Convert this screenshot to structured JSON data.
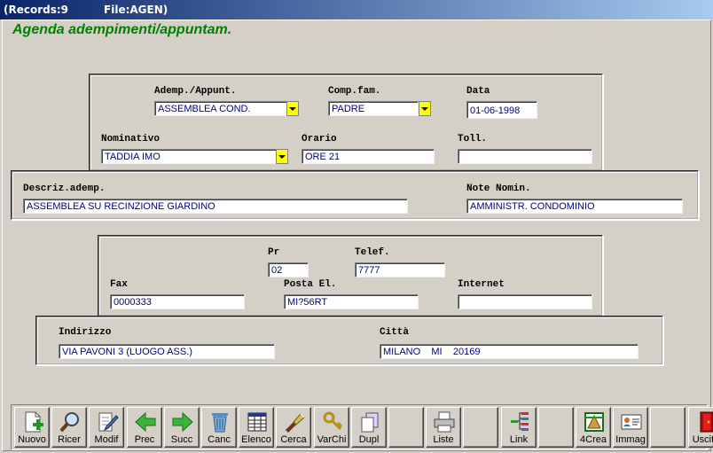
{
  "window": {
    "records": "(Records:9",
    "file": "File:AGEN)"
  },
  "heading": "Agenda adempimenti/appuntam.",
  "fields": {
    "adempimento": {
      "label": "Ademp./Appunt.",
      "value": "ASSEMBLEA COND."
    },
    "comp_fam": {
      "label": "Comp.fam.",
      "value": "PADRE"
    },
    "data": {
      "label": "Data",
      "value": "01-06-1998"
    },
    "nominativo": {
      "label": "Nominativo",
      "value": "TADDIA IMO"
    },
    "orario": {
      "label": "Orario",
      "value": "ORE 21"
    },
    "toll": {
      "label": "Toll.",
      "value": ""
    },
    "descrizione": {
      "label": "Descriz.ademp.",
      "value": "ASSEMBLEA SU RECINZIONE GIARDINO"
    },
    "note": {
      "label": "Note Nomin.",
      "value": "AMMINISTR. CONDOMINIO"
    },
    "pr": {
      "label": "Pr",
      "value": "02"
    },
    "telefono": {
      "label": "Telef.",
      "value": "7777"
    },
    "fax": {
      "label": "Fax",
      "value": "0000333"
    },
    "posta": {
      "label": "Posta El.",
      "value": "MI?56RT"
    },
    "internet": {
      "label": "Internet",
      "value": ""
    },
    "indirizzo": {
      "label": "Indirizzo",
      "value": "VIA PAVONI 3 (LUOGO ASS.)"
    },
    "citta": {
      "label": "Città",
      "value": "MILANO    MI    20169"
    }
  },
  "toolbar": [
    {
      "label": "Nuovo",
      "icon": "new-document-icon"
    },
    {
      "label": "Ricer",
      "icon": "magnifier-icon"
    },
    {
      "label": "Modif",
      "icon": "edit-document-icon"
    },
    {
      "label": "Prec",
      "icon": "arrow-left-icon"
    },
    {
      "label": "Succ",
      "icon": "arrow-right-icon"
    },
    {
      "label": "Canc",
      "icon": "trash-icon"
    },
    {
      "label": "Elenco",
      "icon": "table-icon"
    },
    {
      "label": "Cerca",
      "icon": "flashlight-icon"
    },
    {
      "label": "VarChi",
      "icon": "keys-icon"
    },
    {
      "label": "Dupl",
      "icon": "copy-icon"
    },
    {
      "label": "",
      "icon": ""
    },
    {
      "label": "Liste",
      "icon": "printer-icon"
    },
    {
      "label": "",
      "icon": ""
    },
    {
      "label": "Link",
      "icon": "link-tree-icon"
    },
    {
      "label": "",
      "icon": ""
    },
    {
      "label": "4Crea",
      "icon": "create-icon"
    },
    {
      "label": "Immag",
      "icon": "id-card-icon"
    },
    {
      "label": "",
      "icon": ""
    },
    {
      "label": "Uscita",
      "icon": "exit-door-icon"
    }
  ],
  "colors": {
    "title_green": "#008000",
    "field_text": "#00008b",
    "dropdown_yellow": "#ffff00"
  }
}
